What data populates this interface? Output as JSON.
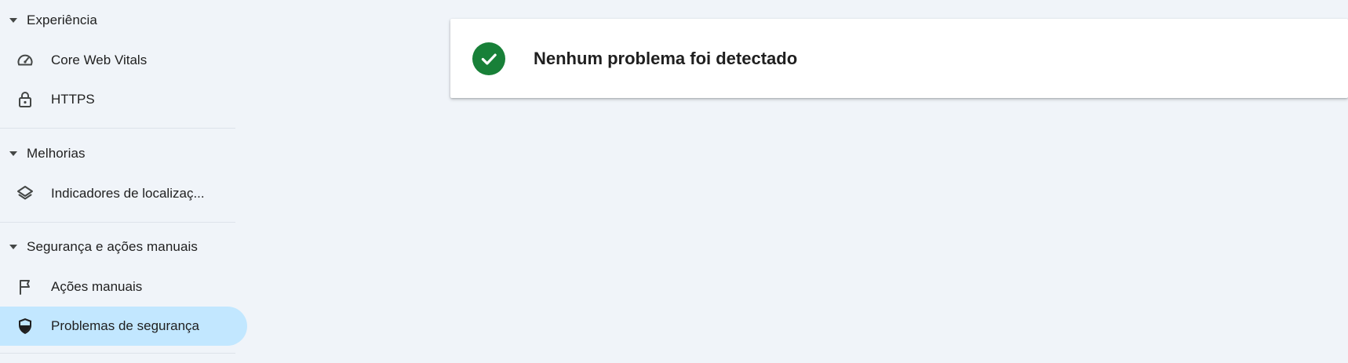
{
  "sidebar": {
    "sections": [
      {
        "title": "Experiência",
        "items": [
          {
            "label": "Core Web Vitals",
            "icon": "speedometer-icon"
          },
          {
            "label": "HTTPS",
            "icon": "lock-icon"
          }
        ]
      },
      {
        "title": "Melhorias",
        "items": [
          {
            "label": "Indicadores de localizaç...",
            "icon": "layers-icon"
          }
        ]
      },
      {
        "title": "Segurança e ações manuais",
        "items": [
          {
            "label": "Ações manuais",
            "icon": "flag-icon"
          },
          {
            "label": "Problemas de segurança",
            "icon": "shield-icon",
            "active": true
          }
        ]
      }
    ]
  },
  "main": {
    "status_card": {
      "text": "Nenhum problema foi detectado",
      "icon": "check-circle-icon",
      "status_color": "#188038"
    }
  },
  "colors": {
    "background": "#f0f4f9",
    "active_item": "#c2e7ff",
    "success": "#188038"
  }
}
